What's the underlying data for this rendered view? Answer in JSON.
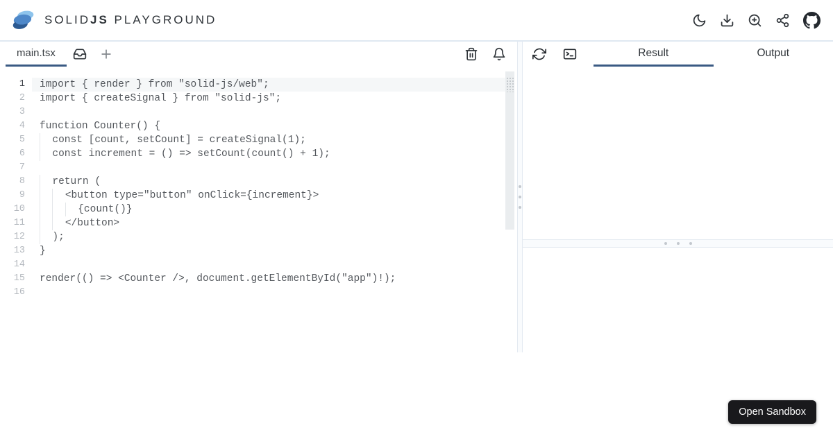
{
  "header": {
    "title_part1": "SOLID",
    "title_part2": "JS",
    "title_part3": " PLAYGROUND",
    "icons": [
      "dark-mode-icon",
      "download-icon",
      "zoom-in-icon",
      "share-icon",
      "github-icon"
    ]
  },
  "tabbar": {
    "file_tab": "main.tsx",
    "icons": [
      "inbox-icon",
      "add-tab-icon",
      "delete-icon",
      "notifications-icon"
    ]
  },
  "editor": {
    "active_line": 1,
    "lines": [
      "import { render } from \"solid-js/web\";",
      "import { createSignal } from \"solid-js\";",
      "",
      "function Counter() {",
      "  const [count, setCount] = createSignal(1);",
      "  const increment = () => setCount(count() + 1);",
      "",
      "  return (",
      "    <button type=\"button\" onClick={increment}>",
      "      {count()}",
      "    </button>",
      "  );",
      "}",
      "",
      "render(() => <Counter />, document.getElementById(\"app\")!);",
      ""
    ]
  },
  "result_panel": {
    "icons": [
      "refresh-icon",
      "terminal-icon"
    ],
    "tabs": [
      {
        "label": "Result",
        "active": true
      },
      {
        "label": "Output",
        "active": false
      }
    ]
  },
  "footer": {
    "open_sandbox_label": "Open Sandbox"
  },
  "colors": {
    "accent": "#3a5a83",
    "header_border": "#dfe8f2",
    "active_line_bg": "#f5f7f8",
    "button_bg": "#19191c",
    "logo_light": "#8ec4ec",
    "logo_mid": "#4e88c9",
    "logo_dark": "#2c5a92"
  }
}
